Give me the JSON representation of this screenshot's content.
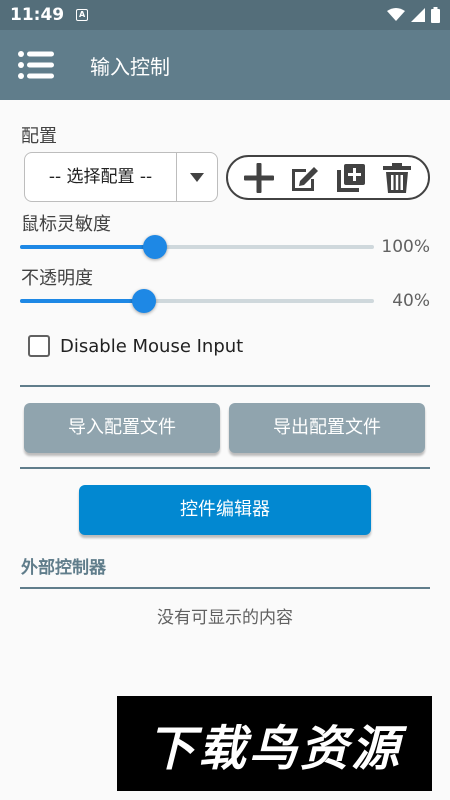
{
  "status_bar": {
    "time": "11:49",
    "notification_letter": "A",
    "icons": [
      "wifi-icon",
      "signal-icon",
      "battery-icon"
    ]
  },
  "app_bar": {
    "menu_icon": "menu-icon",
    "title": "输入控制",
    "color": "#607d8b"
  },
  "config": {
    "label": "配置",
    "select_value": "-- 选择配置 --",
    "tools": [
      "add-icon",
      "edit-icon",
      "copy-icon",
      "delete-icon"
    ]
  },
  "mouse_sensitivity": {
    "label": "鼠标灵敏度",
    "value_text": "100%",
    "fraction": 0.38
  },
  "opacity": {
    "label": "不透明度",
    "value_text": "40%",
    "fraction": 0.35
  },
  "disable_mouse": {
    "label": "Disable Mouse Input",
    "checked": false
  },
  "buttons": {
    "import": "导入配置文件",
    "export": "导出配置文件",
    "editor": "控件编辑器"
  },
  "external": {
    "title": "外部控制器",
    "empty": "没有可显示的内容"
  },
  "watermark": {
    "text": "下载鸟资源"
  },
  "colors": {
    "accent": "#1e88e5",
    "primary_button": "#0288d1",
    "secondary_button": "#90a4ae"
  }
}
